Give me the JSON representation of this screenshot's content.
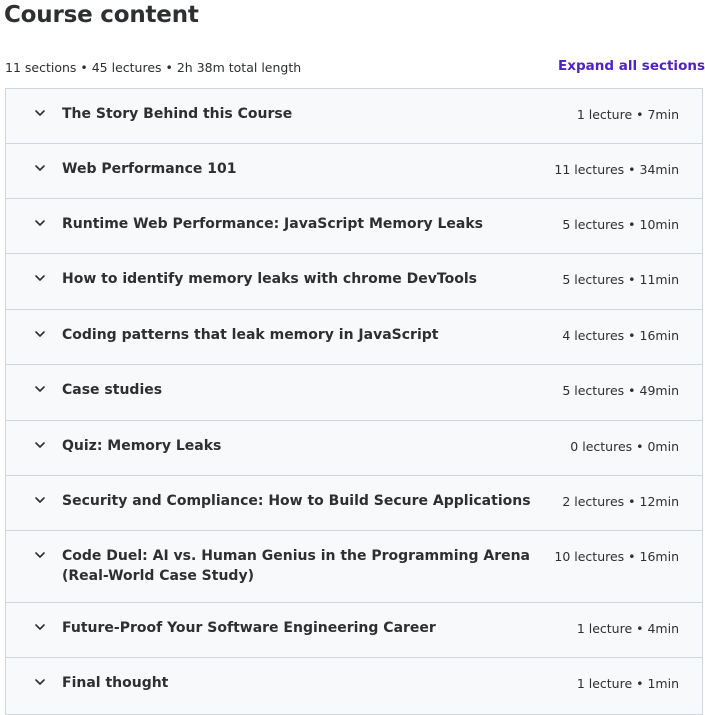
{
  "header": {
    "title": "Course content",
    "summary": "11 sections • 45 lectures • 2h 38m total length",
    "expand_label": "Expand all sections"
  },
  "icons": {
    "section_toggle": "chevron-down-icon"
  },
  "colors": {
    "accent": "#5022c3",
    "section_bg": "#f7f9fa",
    "border": "#d1d7dc",
    "text": "#2d2f31"
  },
  "sections": [
    {
      "title": "The Story Behind this Course",
      "meta": "1 lecture • 7min"
    },
    {
      "title": "Web Performance 101",
      "meta": "11 lectures • 34min"
    },
    {
      "title": "Runtime Web Performance: JavaScript Memory Leaks",
      "meta": "5 lectures • 10min"
    },
    {
      "title": "How to identify memory leaks with chrome DevTools",
      "meta": "5 lectures • 11min"
    },
    {
      "title": "Coding patterns that leak memory in JavaScript",
      "meta": "4 lectures • 16min"
    },
    {
      "title": "Case studies",
      "meta": "5 lectures • 49min"
    },
    {
      "title": "Quiz: Memory Leaks",
      "meta": "0 lectures • 0min"
    },
    {
      "title": "Security and Compliance: How to Build Secure Applications",
      "meta": "2 lectures • 12min"
    },
    {
      "title": "Code Duel: AI vs. Human Genius in the Programming Arena (Real-World Case Study)",
      "meta": "10 lectures • 16min"
    },
    {
      "title": "Future-Proof Your Software Engineering Career",
      "meta": "1 lecture • 4min"
    },
    {
      "title": "Final thought",
      "meta": "1 lecture • 1min"
    }
  ]
}
